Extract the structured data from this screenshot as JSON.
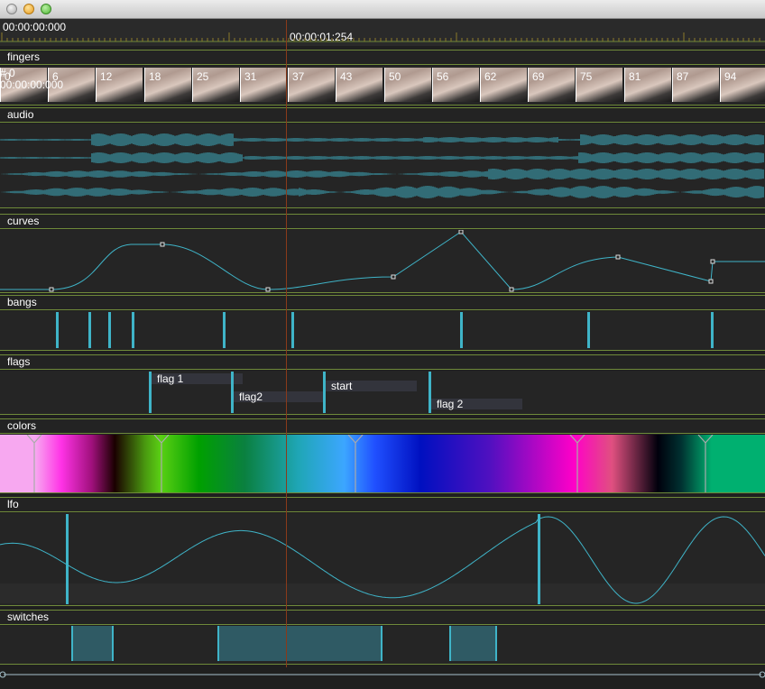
{
  "window": {
    "buttons": [
      "close",
      "minimize",
      "maximize"
    ]
  },
  "timeline": {
    "start_time": "00:00:00:000",
    "playhead_time": "00:00:01:254"
  },
  "tracks": {
    "fingers": {
      "label": "fingers",
      "frame_overlay": "# 0",
      "frame_overlay_time": "00:00:00:000",
      "frame_labels": [
        "0",
        "6",
        "12",
        "18",
        "25",
        "31",
        "37",
        "43",
        "50",
        "56",
        "62",
        "69",
        "75",
        "81",
        "87",
        "94"
      ]
    },
    "audio": {
      "label": "audio"
    },
    "curves": {
      "label": "curves"
    },
    "bangs": {
      "label": "bangs"
    },
    "flags": {
      "label": "flags",
      "items": [
        "flag 1",
        "flag2",
        "start",
        "flag 2"
      ]
    },
    "colors": {
      "label": "colors"
    },
    "lfo": {
      "label": "lfo"
    },
    "switches": {
      "label": "switches"
    }
  },
  "colors": {
    "track_line": "#6f8a3a",
    "accent": "#3fb4c8",
    "playhead": "#8a3a1a",
    "background": "#252525"
  }
}
